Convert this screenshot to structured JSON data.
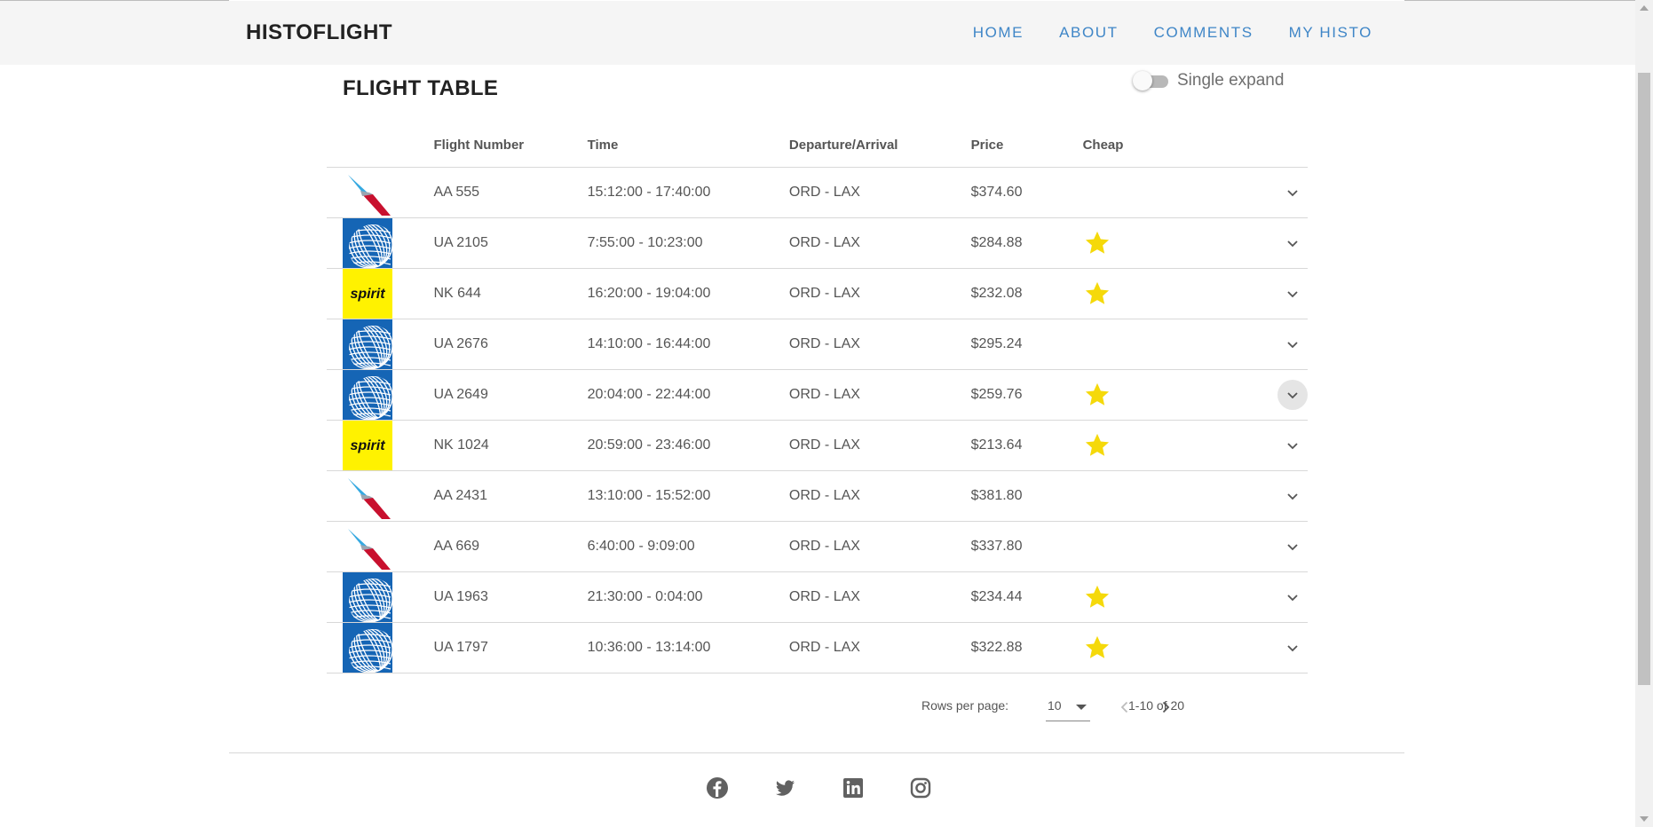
{
  "header": {
    "brand": "HISTOFLIGHT",
    "nav": [
      "HOME",
      "ABOUT",
      "COMMENTS",
      "MY HISTO"
    ]
  },
  "table_card": {
    "title": "FLIGHT TABLE",
    "single_expand_label": "Single expand",
    "single_expand_on": false,
    "columns": [
      "",
      "Flight Number",
      "Time",
      "Departure/Arrival",
      "Price",
      "Cheap",
      ""
    ],
    "rows": [
      {
        "airline": "american",
        "flight": "AA 555",
        "time": "15:12:00 - 17:40:00",
        "route": "ORD - LAX",
        "price": "$374.60",
        "cheap": false
      },
      {
        "airline": "united",
        "flight": "UA 2105",
        "time": "7:55:00 - 10:23:00",
        "route": "ORD - LAX",
        "price": "$284.88",
        "cheap": true
      },
      {
        "airline": "spirit",
        "flight": "NK 644",
        "time": "16:20:00 - 19:04:00",
        "route": "ORD - LAX",
        "price": "$232.08",
        "cheap": true
      },
      {
        "airline": "united",
        "flight": "UA 2676",
        "time": "14:10:00 - 16:44:00",
        "route": "ORD - LAX",
        "price": "$295.24",
        "cheap": false
      },
      {
        "airline": "united",
        "flight": "UA 2649",
        "time": "20:04:00 - 22:44:00",
        "route": "ORD - LAX",
        "price": "$259.76",
        "cheap": true,
        "hovered": true
      },
      {
        "airline": "spirit",
        "flight": "NK 1024",
        "time": "20:59:00 - 23:46:00",
        "route": "ORD - LAX",
        "price": "$213.64",
        "cheap": true
      },
      {
        "airline": "american",
        "flight": "AA 2431",
        "time": "13:10:00 - 15:52:00",
        "route": "ORD - LAX",
        "price": "$381.80",
        "cheap": false
      },
      {
        "airline": "american",
        "flight": "AA 669",
        "time": "6:40:00 - 9:09:00",
        "route": "ORD - LAX",
        "price": "$337.80",
        "cheap": false
      },
      {
        "airline": "united",
        "flight": "UA 1963",
        "time": "21:30:00 - 0:04:00",
        "route": "ORD - LAX",
        "price": "$234.44",
        "cheap": true
      },
      {
        "airline": "united",
        "flight": "UA 1797",
        "time": "10:36:00 - 13:14:00",
        "route": "ORD - LAX",
        "price": "$322.88",
        "cheap": true
      }
    ],
    "spirit_logo_text": "spirit",
    "pagination": {
      "rows_per_page_label": "Rows per page:",
      "rows_per_page": "10",
      "range": "1-10 of 20"
    }
  },
  "footer": {
    "social": [
      "facebook-icon",
      "twitter-icon",
      "linkedin-icon",
      "instagram-icon"
    ]
  },
  "colors": {
    "nav_link": "#3f86c7",
    "star": "#f5d90a",
    "united_blue": "#1565b5",
    "spirit_yellow": "#fff200",
    "aa_red": "#c8102e",
    "aa_blue": "#36a9e1"
  }
}
